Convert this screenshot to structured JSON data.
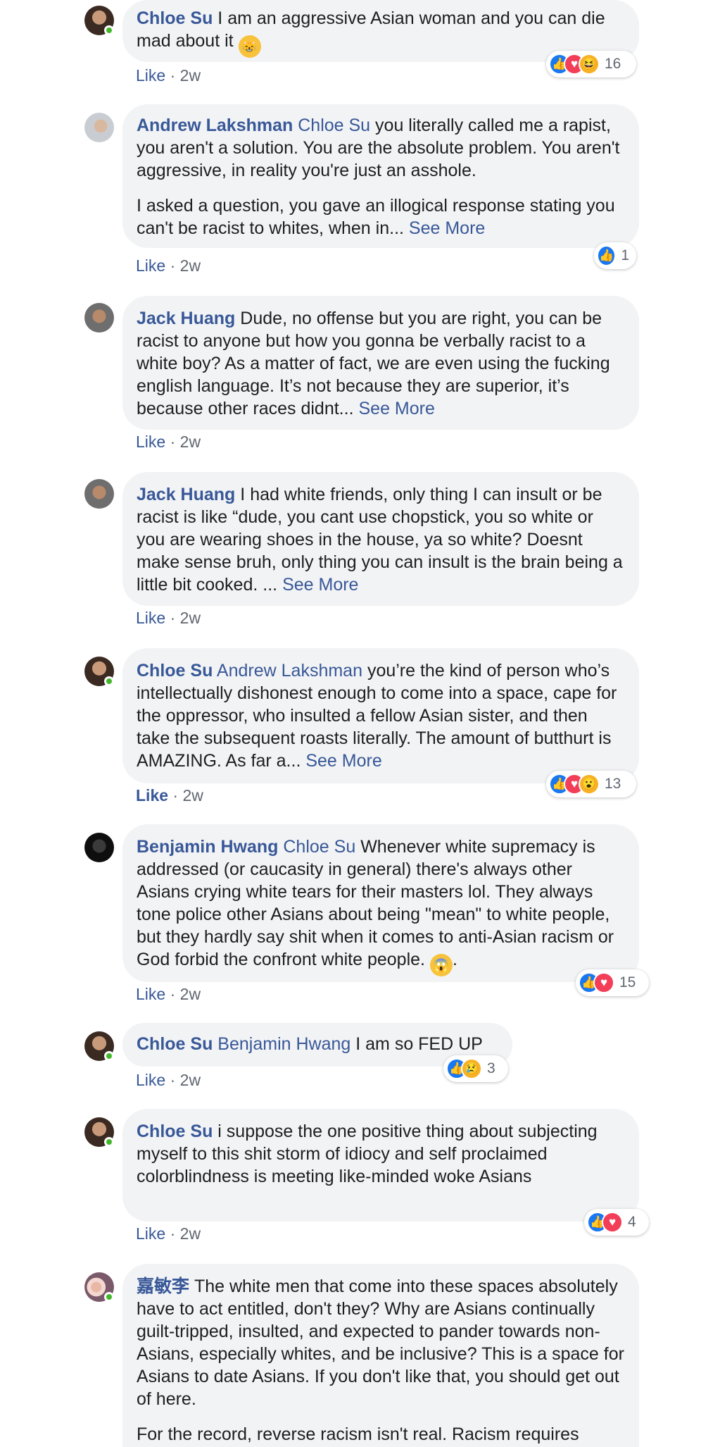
{
  "comments": [
    {
      "author": "Chloe Su",
      "mention": "",
      "online": true,
      "paragraphs": [
        "I am an aggressive Asian woman and you can die mad about it"
      ],
      "emoji": "cat-smile",
      "see_more": "",
      "like": "Like",
      "time": "2w",
      "reactions": [
        "like",
        "love",
        "haha"
      ],
      "reaction_count": "16"
    },
    {
      "author": "Andrew Lakshman",
      "mention": "Chloe Su",
      "online": false,
      "paragraphs": [
        "you literally called me a rapist, you aren't a solution. You are the absolute problem. You aren't aggressive, in reality you're just an asshole.",
        "I asked a question, you gave an illogical response stating you can't be racist to whites, when in..."
      ],
      "see_more": "See More",
      "like": "Like",
      "time": "2w",
      "reactions": [
        "like"
      ],
      "reaction_count": "1"
    },
    {
      "author": "Jack Huang",
      "mention": "",
      "online": false,
      "paragraphs": [
        "Dude, no offense but you are right, you can be racist to anyone but how you gonna be verbally racist to a white boy? As a matter of fact, we are even using the fucking english language. It’s not because they are superior, it’s because other races didnt..."
      ],
      "see_more": "See More",
      "like": "Like",
      "time": "2w",
      "reactions": [],
      "reaction_count": ""
    },
    {
      "author": "Jack Huang",
      "mention": "",
      "online": false,
      "paragraphs": [
        "I had white friends, only thing I can insult or be racist is like “dude, you cant use chopstick, you so white or you are wearing shoes in the house, ya so white? Doesnt make sense bruh, only thing you can insult is the brain being a little bit cooked. ..."
      ],
      "see_more": "See More",
      "like": "Like",
      "time": "2w",
      "reactions": [],
      "reaction_count": ""
    },
    {
      "author": "Chloe Su",
      "mention": "Andrew Lakshman",
      "online": true,
      "paragraphs": [
        "you’re the kind of person who’s intellectually dishonest enough to come into a space, cape for the oppressor, who insulted a fellow Asian sister, and then take the subsequent roasts literally. The amount of butthurt is AMAZING. As far a..."
      ],
      "see_more": "See More",
      "like": "Like",
      "time": "2w",
      "reactions": [
        "like",
        "love",
        "wow"
      ],
      "reaction_count": "13"
    },
    {
      "author": "Benjamin Hwang",
      "mention": "Chloe Su",
      "online": false,
      "paragraphs": [
        "Whenever white supremacy is addressed (or caucasity in general) there's always other Asians crying white tears for their masters lol. They always tone police other Asians about being \"mean\" to white people, but they hardly say shit when it comes to anti-Asian racism or God forbid the confront white people."
      ],
      "emoji": "scream",
      "see_more": "",
      "like": "Like",
      "time": "2w",
      "reactions": [
        "like",
        "love"
      ],
      "reaction_count": "15"
    },
    {
      "author": "Chloe Su",
      "mention": "Benjamin Hwang",
      "online": true,
      "paragraphs": [
        "I am so FED UP"
      ],
      "see_more": "",
      "like": "Like",
      "time": "2w",
      "reactions": [
        "like",
        "sad"
      ],
      "reaction_count": "3"
    },
    {
      "author": "Chloe Su",
      "mention": "",
      "online": true,
      "paragraphs": [
        "i suppose the one positive thing about subjecting myself to this shit storm of idiocy and self proclaimed colorblindness is meeting like-minded woke Asians"
      ],
      "see_more": "",
      "like": "Like",
      "time": "2w",
      "reactions": [
        "like",
        "love"
      ],
      "reaction_count": "4"
    },
    {
      "author": "嘉敏李",
      "mention": "",
      "online": true,
      "paragraphs": [
        "The white men that come into these spaces absolutely have to act entitled, don't they? Why are Asians continually guilt-tripped, insulted, and expected to pander towards non-Asians, especially whites, and be inclusive? This is a space for Asians to date Asians. If you don't like that, you should get out of here.",
        "For the record, reverse racism isn't real. Racism requires"
      ],
      "see_more": "",
      "like": "",
      "time": "",
      "reactions": [],
      "reaction_count": ""
    }
  ],
  "colors": {
    "link": "#385898",
    "bubble": "#f2f3f5",
    "online": "#42b72a",
    "like": "#1877f2",
    "love": "#f33e58"
  }
}
